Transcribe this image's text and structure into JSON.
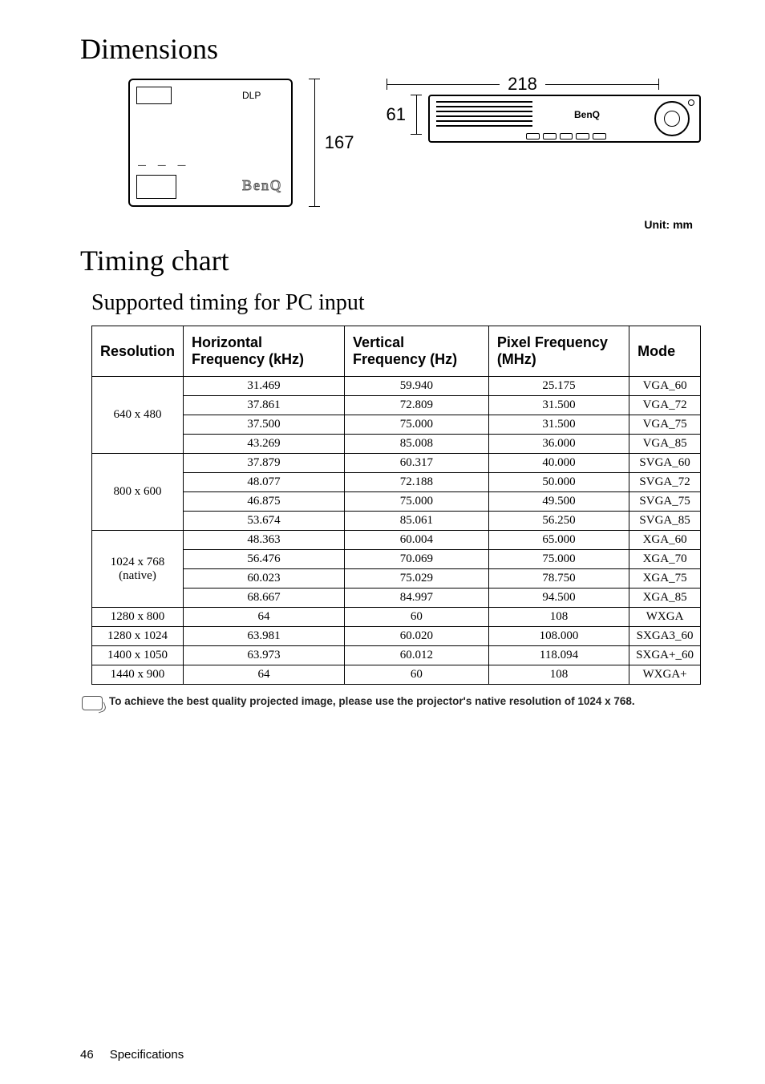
{
  "headings": {
    "dimensions": "Dimensions",
    "timing_chart": "Timing chart",
    "supported_timing": "Supported timing for PC input"
  },
  "dimensions_figure": {
    "height_167": "167",
    "height_61": "61",
    "width_218": "218",
    "top_box_brand": "BenQ",
    "top_box_logo": "DLP",
    "front_brand": "BenQ"
  },
  "unit_label": "Unit: mm",
  "table": {
    "headers": {
      "resolution": "Resolution",
      "hfreq": "Horizontal Frequency (kHz)",
      "vfreq": "Vertical Frequency (Hz)",
      "pfreq": "Pixel Frequency (MHz)",
      "mode": "Mode"
    },
    "groups": [
      {
        "resolution": "640 x 480",
        "rows": [
          {
            "h": "31.469",
            "v": "59.940",
            "p": "25.175",
            "m": "VGA_60"
          },
          {
            "h": "37.861",
            "v": "72.809",
            "p": "31.500",
            "m": "VGA_72"
          },
          {
            "h": "37.500",
            "v": "75.000",
            "p": "31.500",
            "m": "VGA_75"
          },
          {
            "h": "43.269",
            "v": "85.008",
            "p": "36.000",
            "m": "VGA_85"
          }
        ]
      },
      {
        "resolution": "800 x 600",
        "rows": [
          {
            "h": "37.879",
            "v": "60.317",
            "p": "40.000",
            "m": "SVGA_60"
          },
          {
            "h": "48.077",
            "v": "72.188",
            "p": "50.000",
            "m": "SVGA_72"
          },
          {
            "h": "46.875",
            "v": "75.000",
            "p": "49.500",
            "m": "SVGA_75"
          },
          {
            "h": "53.674",
            "v": "85.061",
            "p": "56.250",
            "m": "SVGA_85"
          }
        ]
      },
      {
        "resolution": "1024 x 768 (native)",
        "rows": [
          {
            "h": "48.363",
            "v": "60.004",
            "p": "65.000",
            "m": "XGA_60"
          },
          {
            "h": "56.476",
            "v": "70.069",
            "p": "75.000",
            "m": "XGA_70"
          },
          {
            "h": "60.023",
            "v": "75.029",
            "p": "78.750",
            "m": "XGA_75"
          },
          {
            "h": "68.667",
            "v": "84.997",
            "p": "94.500",
            "m": "XGA_85"
          }
        ]
      },
      {
        "resolution": "1280 x 800",
        "rows": [
          {
            "h": "64",
            "v": "60",
            "p": "108",
            "m": "WXGA"
          }
        ]
      },
      {
        "resolution": "1280 x 1024",
        "rows": [
          {
            "h": "63.981",
            "v": "60.020",
            "p": "108.000",
            "m": "SXGA3_60"
          }
        ]
      },
      {
        "resolution": "1400 x 1050",
        "rows": [
          {
            "h": "63.973",
            "v": "60.012",
            "p": "118.094",
            "m": "SXGA+_60"
          }
        ]
      },
      {
        "resolution": "1440 x 900",
        "rows": [
          {
            "h": "64",
            "v": "60",
            "p": "108",
            "m": "WXGA+"
          }
        ]
      }
    ]
  },
  "note": "To achieve the best quality projected image, please use the projector's native resolution of 1024 x 768.",
  "footer": {
    "page": "46",
    "section": "Specifications"
  },
  "chart_data": {
    "type": "table",
    "title": "Supported timing for PC input",
    "columns": [
      "Resolution",
      "Horizontal Frequency (kHz)",
      "Vertical Frequency (Hz)",
      "Pixel Frequency (MHz)",
      "Mode"
    ],
    "rows": [
      [
        "640 x 480",
        "31.469",
        "59.940",
        "25.175",
        "VGA_60"
      ],
      [
        "640 x 480",
        "37.861",
        "72.809",
        "31.500",
        "VGA_72"
      ],
      [
        "640 x 480",
        "37.500",
        "75.000",
        "31.500",
        "VGA_75"
      ],
      [
        "640 x 480",
        "43.269",
        "85.008",
        "36.000",
        "VGA_85"
      ],
      [
        "800 x 600",
        "37.879",
        "60.317",
        "40.000",
        "SVGA_60"
      ],
      [
        "800 x 600",
        "48.077",
        "72.188",
        "50.000",
        "SVGA_72"
      ],
      [
        "800 x 600",
        "46.875",
        "75.000",
        "49.500",
        "SVGA_75"
      ],
      [
        "800 x 600",
        "53.674",
        "85.061",
        "56.250",
        "SVGA_85"
      ],
      [
        "1024 x 768 (native)",
        "48.363",
        "60.004",
        "65.000",
        "XGA_60"
      ],
      [
        "1024 x 768 (native)",
        "56.476",
        "70.069",
        "75.000",
        "XGA_70"
      ],
      [
        "1024 x 768 (native)",
        "60.023",
        "75.029",
        "78.750",
        "XGA_75"
      ],
      [
        "1024 x 768 (native)",
        "68.667",
        "84.997",
        "94.500",
        "XGA_85"
      ],
      [
        "1280 x 800",
        "64",
        "60",
        "108",
        "WXGA"
      ],
      [
        "1280 x 1024",
        "63.981",
        "60.020",
        "108.000",
        "SXGA3_60"
      ],
      [
        "1400 x 1050",
        "63.973",
        "60.012",
        "118.094",
        "SXGA+_60"
      ],
      [
        "1440 x 900",
        "64",
        "60",
        "108",
        "WXGA+"
      ]
    ]
  }
}
